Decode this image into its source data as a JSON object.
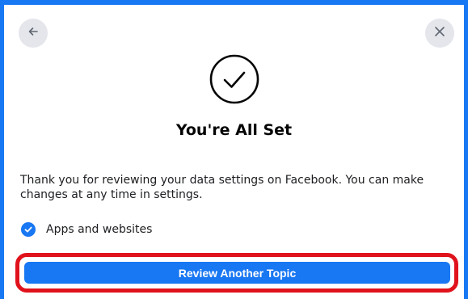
{
  "header": {
    "back_icon": "arrow-left-icon",
    "close_icon": "close-icon"
  },
  "status_icon": "check-circle-icon",
  "title": "You're All Set",
  "description": "Thank you for reviewing your data settings on Facebook. You can make changes at any time in settings.",
  "settings": [
    {
      "label": "Apps and websites",
      "checked": true,
      "icon": "check-badge-icon"
    }
  ],
  "actions": {
    "primary_label": "Review Another Topic"
  },
  "colors": {
    "accent": "#1877f2",
    "highlight": "#e0121b",
    "nav_button_bg": "#e4e6eb"
  }
}
